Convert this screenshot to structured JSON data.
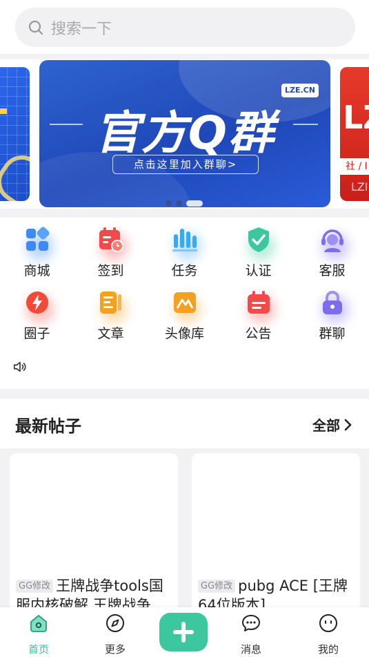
{
  "search": {
    "placeholder": "搜索一下"
  },
  "banner": {
    "main_title": "官方Q群",
    "main_tag": "LZE.CN",
    "main_cta": "点击这里加入群聊>",
    "right_big": "LZ",
    "right_band": "社 / I",
    "right_foot": "LZI",
    "active_slide": 3,
    "slide_count": 3
  },
  "functions": [
    {
      "label": "商城",
      "icon": "apps-icon",
      "color": "#3d8af7"
    },
    {
      "label": "签到",
      "icon": "calendar-check-icon",
      "color": "#f24a4a"
    },
    {
      "label": "任务",
      "icon": "bar-chart-icon",
      "color": "#3aa9f5"
    },
    {
      "label": "认证",
      "icon": "shield-check-icon",
      "color": "#3cc79e"
    },
    {
      "label": "客服",
      "icon": "customer-service-icon",
      "color": "#7c6cf0"
    },
    {
      "label": "圈子",
      "icon": "lightning-icon",
      "color": "#f24a3a"
    },
    {
      "label": "文章",
      "icon": "article-icon",
      "color": "#f5a021"
    },
    {
      "label": "头像库",
      "icon": "mountain-image-icon",
      "color": "#f5a021"
    },
    {
      "label": "公告",
      "icon": "announcement-icon",
      "color": "#f24a4a"
    },
    {
      "label": "群聊",
      "icon": "lock-icon",
      "color": "#7c6cf0"
    }
  ],
  "latest": {
    "title": "最新帖子",
    "more": "全部"
  },
  "posts": [
    {
      "badge": "GG修改",
      "text": "王牌战争tools国服内核破解 王牌战争"
    },
    {
      "badge": "GG修改",
      "text": "pubg ACE [王牌64位版本]"
    }
  ],
  "tabs": [
    {
      "label": "首页",
      "icon": "home-icon",
      "active": true
    },
    {
      "label": "更多",
      "icon": "compass-icon",
      "active": false
    },
    {
      "label": "消息",
      "icon": "chat-icon",
      "active": false
    },
    {
      "label": "我的",
      "icon": "smile-icon",
      "active": false
    }
  ],
  "colors": {
    "accent": "#3cc79e",
    "banner_blue": "#1f48b8"
  }
}
